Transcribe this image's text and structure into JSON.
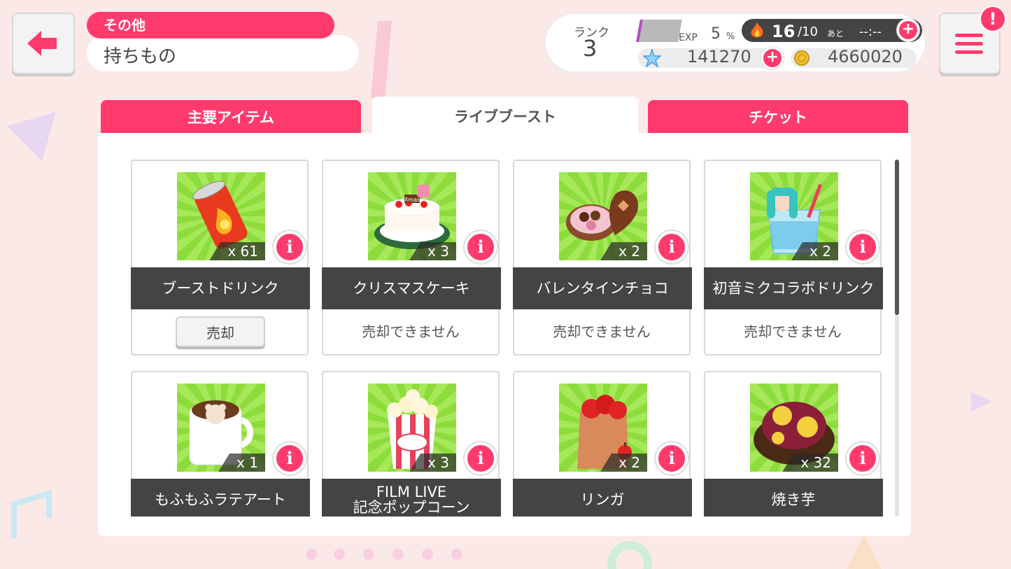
{
  "header": {
    "category": "その他",
    "title": "持ちもの"
  },
  "status": {
    "rank_label": "ランク",
    "rank_value": "3",
    "exp_label": "EXP",
    "exp_value": "5",
    "exp_unit": "%",
    "exp_progress_percent": 5,
    "stamina_value": "16",
    "stamina_max": "/10",
    "stamina_suffix": "あと",
    "stamina_timer": "--:--",
    "star_value": "141270",
    "coin_value": "4660020"
  },
  "menu": {
    "badge": "!"
  },
  "tabs": [
    {
      "label": "主要アイテム"
    },
    {
      "label": "ライブブースト",
      "active": true
    },
    {
      "label": "チケット"
    }
  ],
  "items": [
    {
      "name": "ブーストドリンク",
      "qty": "x 61",
      "action": "売却",
      "sellable": true,
      "icon": "energy-drink-can-icon"
    },
    {
      "name": "クリスマスケーキ",
      "qty": "x 3",
      "action": "売却できません",
      "sellable": false,
      "icon": "christmas-cake-icon"
    },
    {
      "name": "バレンタインチョコ",
      "qty": "x 2",
      "action": "売却できません",
      "sellable": false,
      "icon": "valentine-chocolate-box-icon"
    },
    {
      "name": "初音ミクコラボドリンク",
      "qty": "x 2",
      "action": "売却できません",
      "sellable": false,
      "icon": "miku-collab-drink-icon"
    },
    {
      "name": "もふもふラテアート",
      "qty": "x 1",
      "action": "",
      "sellable": false,
      "icon": "latte-art-mug-icon"
    },
    {
      "name": "FILM LIVE\n記念ポップコーン",
      "qty": "x 3",
      "action": "",
      "sellable": false,
      "icon": "popcorn-icon"
    },
    {
      "name": "リンガ",
      "qty": "x 2",
      "action": "",
      "sellable": false,
      "icon": "apple-bag-icon"
    },
    {
      "name": "焼き芋",
      "qty": "x 32",
      "action": "",
      "sellable": false,
      "icon": "sweet-potato-icon"
    }
  ],
  "info_symbol": "i",
  "colors": {
    "accent": "#ff3b6e",
    "band": "#444444",
    "thumb_bg": "#8ddc3c"
  }
}
